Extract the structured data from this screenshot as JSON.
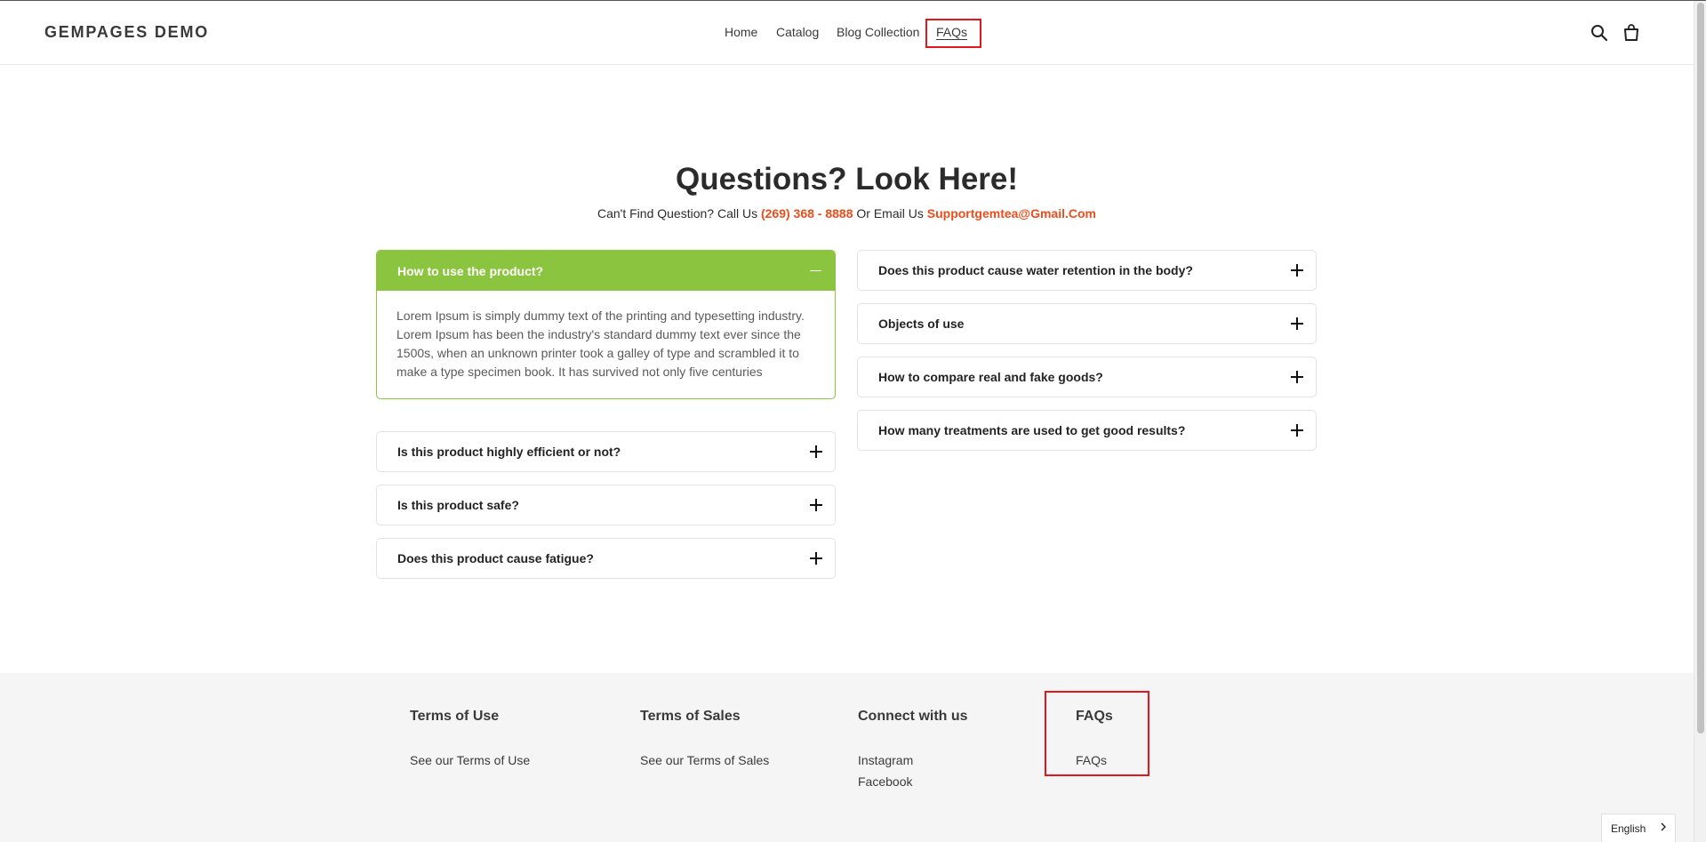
{
  "header": {
    "logo": "GEMPAGES DEMO",
    "nav": [
      "Home",
      "Catalog",
      "Blog Collection",
      "FAQs"
    ],
    "active_nav": "FAQs",
    "icons": [
      "search-icon",
      "cart-icon"
    ]
  },
  "hero": {
    "title": "Questions? Look Here!",
    "subtitle_prefix": "Can't Find Question? Call Us",
    "phone": "(269) 368 - 8888",
    "subtitle_mid": "Or Email Us",
    "email": "Supportgemtea@Gmail.Com"
  },
  "faq": {
    "left": [
      {
        "question": "How to use the product?",
        "answer": "Lorem Ipsum is simply dummy text of the printing and typesetting industry. Lorem Ipsum has been the industry's standard dummy text ever since the 1500s, when an unknown printer took a galley of type and scrambled it to make a type specimen book. It has survived not only five centuries",
        "expanded": true
      },
      {
        "question": "Is this product highly efficient or not?",
        "expanded": false
      },
      {
        "question": "Is this product safe?",
        "expanded": false
      },
      {
        "question": "Does this product cause fatigue?",
        "expanded": false
      }
    ],
    "right": [
      {
        "question": "Does this product cause water retention in the body?",
        "expanded": false
      },
      {
        "question": "Objects of use",
        "expanded": false
      },
      {
        "question": "How to compare real and fake goods?",
        "expanded": false
      },
      {
        "question": "How many treatments are used to get good results?",
        "expanded": false
      }
    ]
  },
  "footer": {
    "columns": [
      {
        "heading": "Terms of Use",
        "links": [
          "See our Terms of Use"
        ]
      },
      {
        "heading": "Terms of Sales",
        "links": [
          "See our Terms of Sales"
        ]
      },
      {
        "heading": "Connect with us",
        "links": [
          "Instagram",
          "Facebook"
        ]
      },
      {
        "heading": "FAQs",
        "links": [
          "FAQs"
        ]
      }
    ],
    "language": "English"
  },
  "colors": {
    "accent_green": "#8bc53f",
    "accent_orange": "#ee4c1a",
    "highlight_red": "#e3171b",
    "footer_bg": "#f5f5f5"
  }
}
